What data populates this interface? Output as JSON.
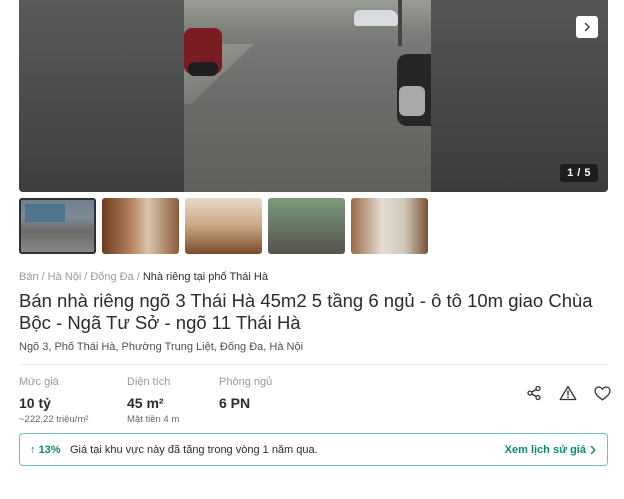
{
  "gallery": {
    "counter": "1 / 5",
    "next_icon": "chevron-right-icon",
    "thumbnail_count": 5
  },
  "breadcrumb": {
    "items": [
      "Bán",
      "Hà Nội",
      "Đống Đa"
    ],
    "current": "Nhà riêng tại phố Thái Hà",
    "separator": "/"
  },
  "listing": {
    "title": "Bán nhà riêng ngõ 3 Thái Hà 45m2 5 tầng 6 ngủ - ô tô 10m giao Chùa Bộc - Ngã Tư Sở - ngõ 11 Thái Hà",
    "address": "Ngõ 3, Phố Thái Hà, Phường Trung Liệt, Đống Đa, Hà Nội"
  },
  "stats": {
    "price": {
      "label": "Mức giá",
      "value": "10 tỷ",
      "sub": "~222,22 triệu/m²"
    },
    "area": {
      "label": "Diện tích",
      "value": "45 m²",
      "sub": "Mặt tiền 4 m"
    },
    "bedrooms": {
      "label": "Phòng ngủ",
      "value": "6 PN"
    }
  },
  "actions": {
    "icons": [
      "share-icon",
      "report-icon",
      "heart-icon"
    ]
  },
  "trend": {
    "percent": "13%",
    "message": "Giá tại khu vực này đã tăng trong vòng 1 năm qua.",
    "link": "Xem lịch sử giá"
  },
  "colors": {
    "accent": "#0e8a6b",
    "border_accent": "#6fc3ad",
    "text": "#2c2c2c",
    "muted": "#999999"
  }
}
